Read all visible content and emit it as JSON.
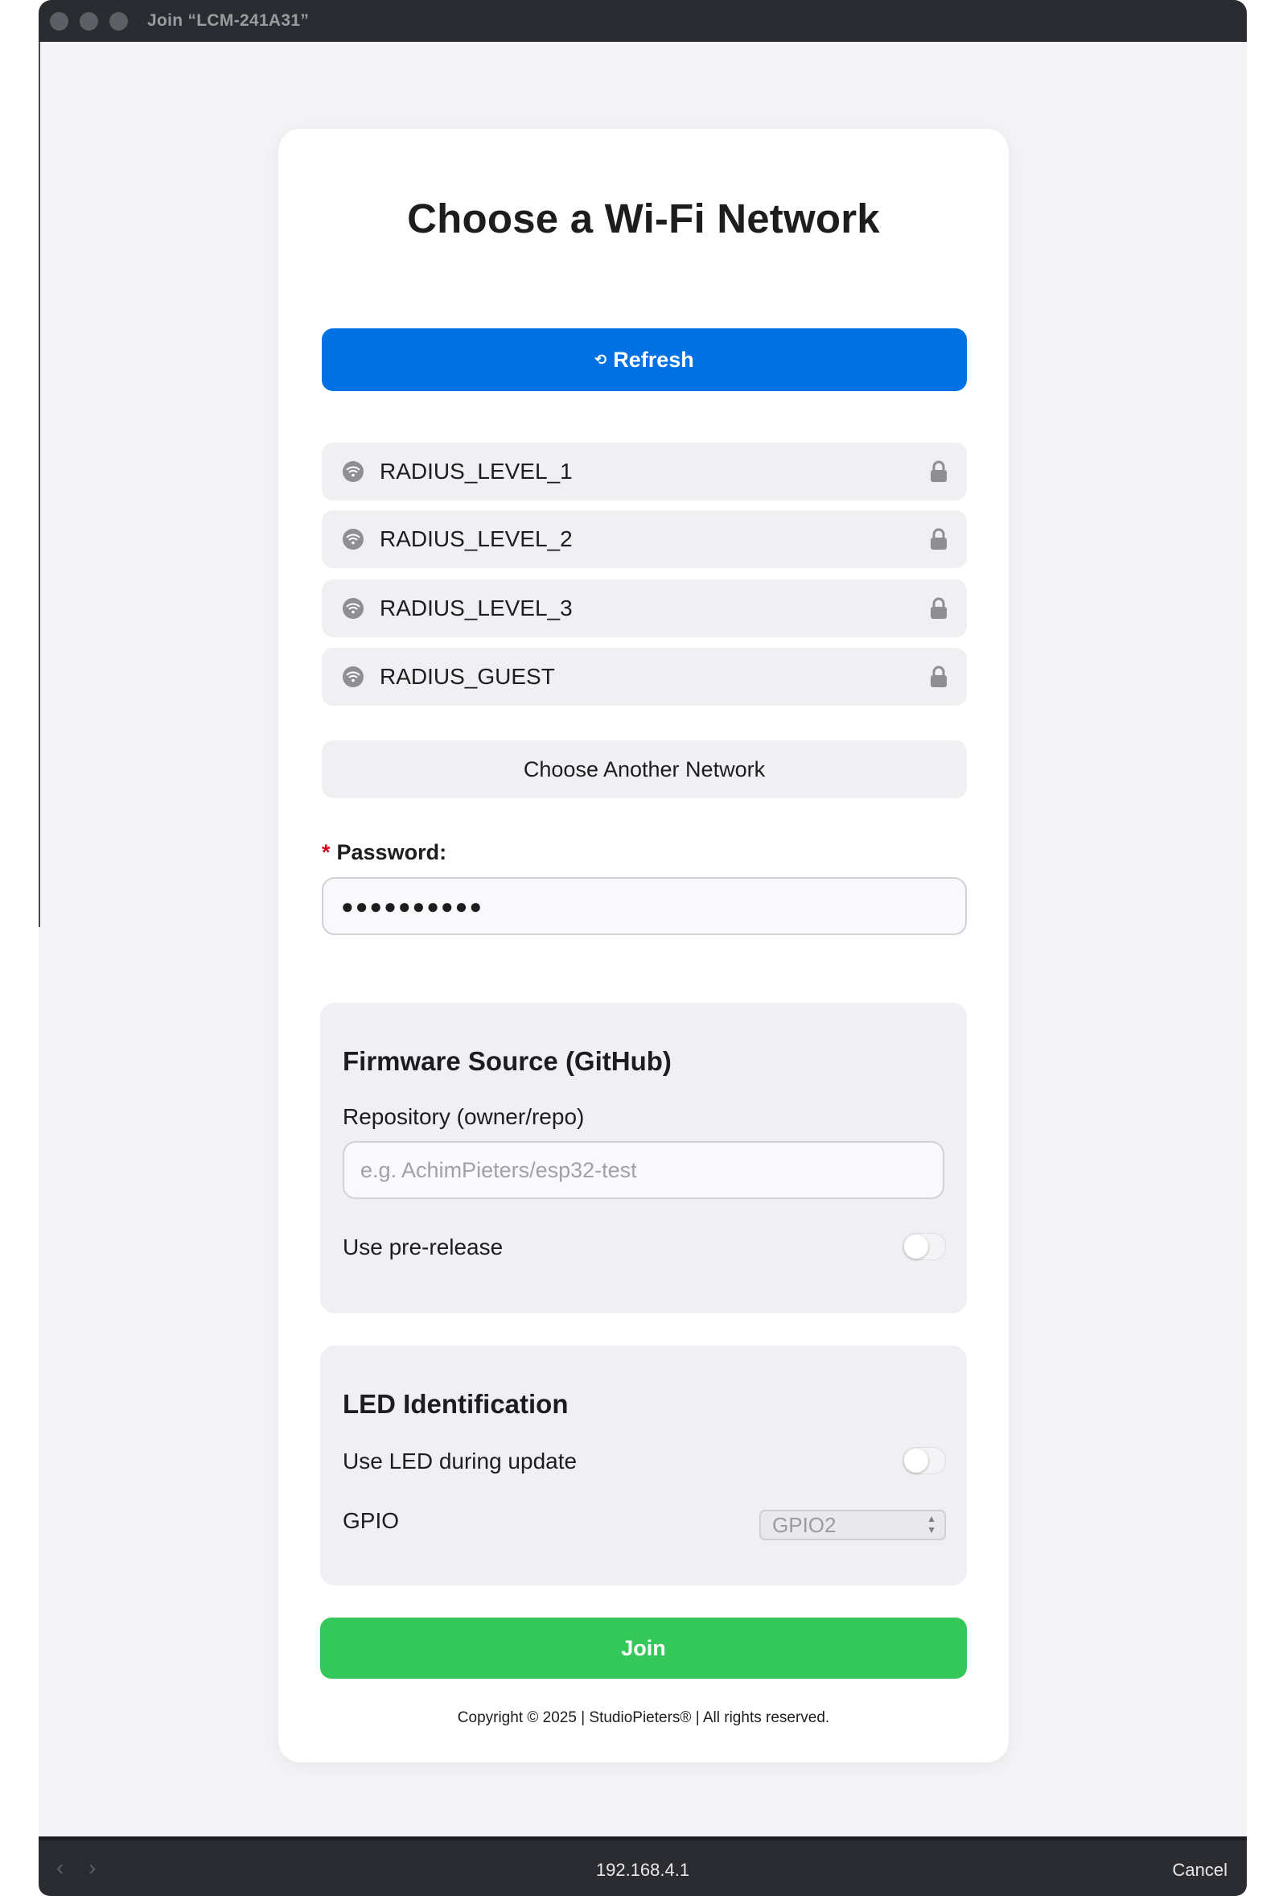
{
  "window": {
    "title": "Join “LCM-241A31”"
  },
  "page": {
    "heading": "Choose a Wi-Fi Network",
    "refresh": {
      "icon": "⟲",
      "label": "Refresh"
    },
    "networks": [
      {
        "name": "RADIUS_LEVEL_1",
        "secured": true
      },
      {
        "name": "RADIUS_LEVEL_2",
        "secured": true
      },
      {
        "name": "RADIUS_LEVEL_3",
        "secured": true
      },
      {
        "name": "RADIUS_GUEST",
        "secured": true
      }
    ],
    "choose_another": "Choose Another Network",
    "password": {
      "required_mark": "*",
      "label": "Password:",
      "value": "●●●●●●●●●●"
    },
    "firmware": {
      "title": "Firmware Source (GitHub)",
      "repo_label": "Repository (owner/repo)",
      "repo_placeholder": "e.g. AchimPieters/esp32-test",
      "prerelease_label": "Use pre-release",
      "prerelease_on": false
    },
    "led": {
      "title": "LED Identification",
      "use_led_label": "Use LED during update",
      "use_led_on": false,
      "gpio_label": "GPIO",
      "gpio_value": "GPIO2"
    },
    "join": "Join",
    "copyright": "Copyright © 2025 | StudioPieters® | All rights reserved."
  },
  "bottombar": {
    "back": "‹",
    "forward": "›",
    "url": "192.168.4.1",
    "cancel": "Cancel"
  },
  "colors": {
    "accent_blue": "#0071e3",
    "join_green": "#34c759",
    "required_red": "#d70015"
  }
}
